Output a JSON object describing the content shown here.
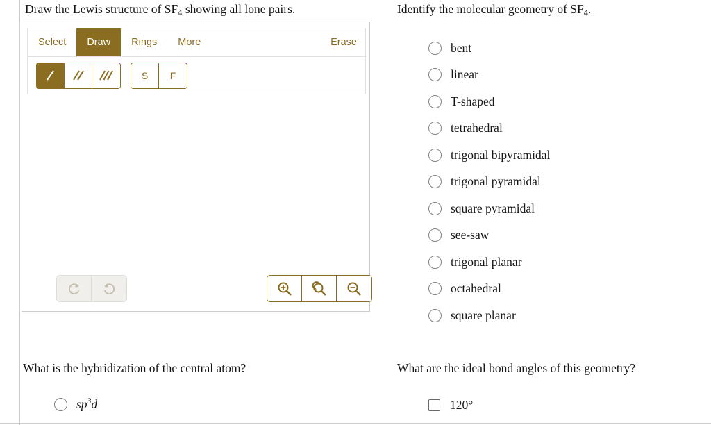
{
  "left": {
    "prompt": {
      "before": "Draw the Lewis structure of SF",
      "sub": "4",
      "after": " showing all lone pairs."
    },
    "sketcher": {
      "tabs": [
        {
          "label": "Select",
          "active": false
        },
        {
          "label": "Draw",
          "active": true
        },
        {
          "label": "Rings",
          "active": false
        },
        {
          "label": "More",
          "active": false
        }
      ],
      "erase_label": "Erase",
      "bond_tools": [
        {
          "name": "single-bond",
          "active": true
        },
        {
          "name": "double-bond",
          "active": false
        },
        {
          "name": "triple-bond",
          "active": false
        }
      ],
      "atom_tools": [
        {
          "label": "S",
          "active": false
        },
        {
          "label": "F",
          "active": false
        }
      ],
      "history_buttons": [
        {
          "name": "redo",
          "enabled": false
        },
        {
          "name": "undo",
          "enabled": false
        }
      ],
      "zoom_buttons": [
        {
          "name": "zoom-in",
          "enabled": true
        },
        {
          "name": "reset-zoom",
          "enabled": true
        },
        {
          "name": "zoom-out",
          "enabled": true
        }
      ]
    },
    "hybridization": {
      "question": "What is the hybridization of the central atom?",
      "options": [
        {
          "base_a": "sp",
          "sup": "3",
          "base_b": "d",
          "selected": false
        }
      ]
    }
  },
  "right": {
    "prompt": {
      "before": "Identify the molecular geometry of SF",
      "sub": "4",
      "after": "."
    },
    "geometry_options": [
      {
        "label": "bent",
        "selected": false
      },
      {
        "label": "linear",
        "selected": false
      },
      {
        "label": "T-shaped",
        "selected": false
      },
      {
        "label": "tetrahedral",
        "selected": false
      },
      {
        "label": "trigonal bipyramidal",
        "selected": false
      },
      {
        "label": "trigonal pyramidal",
        "selected": false
      },
      {
        "label": "square pyramidal",
        "selected": false
      },
      {
        "label": "see-saw",
        "selected": false
      },
      {
        "label": "trigonal planar",
        "selected": false
      },
      {
        "label": "octahedral",
        "selected": false
      },
      {
        "label": "square planar",
        "selected": false
      }
    ],
    "bond_angles": {
      "question": "What are the ideal bond angles of this geometry?",
      "options": [
        {
          "label": "120°",
          "checked": false
        }
      ]
    }
  },
  "colors": {
    "accent_gold": "#8a6d20",
    "panel_border": "#cccccc",
    "toolbar_border": "#e3e3e3",
    "disabled_gray": "#c3bda9",
    "radio_gray": "#818181"
  }
}
